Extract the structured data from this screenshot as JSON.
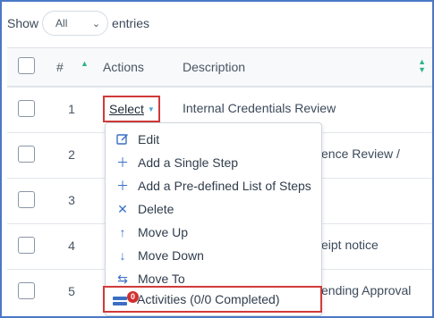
{
  "length_control": {
    "show_label": "Show",
    "selected": "All",
    "entries_label": "entries"
  },
  "table": {
    "headers": {
      "number": "#",
      "actions": "Actions",
      "description": "Description"
    },
    "rows": [
      {
        "number": "1",
        "description": "Internal Credentials Review"
      },
      {
        "number": "2",
        "description": "ence Review /"
      },
      {
        "number": "3",
        "description": ""
      },
      {
        "number": "4",
        "description": "eipt notice"
      },
      {
        "number": "5",
        "description": "ending Approval"
      }
    ],
    "select_label": "Select"
  },
  "action_menu": {
    "items": [
      {
        "label": "Edit",
        "icon": "edit-icon"
      },
      {
        "label": "Add a Single Step",
        "icon": "plus-icon"
      },
      {
        "label": "Add a Pre-defined List of Steps",
        "icon": "plus-icon"
      },
      {
        "label": "Delete",
        "icon": "close-icon"
      },
      {
        "label": "Move Up",
        "icon": "arrow-up-icon"
      },
      {
        "label": "Move Down",
        "icon": "arrow-down-icon"
      },
      {
        "label": "Move To",
        "icon": "swap-arrows-icon"
      },
      {
        "label": "Activities (0/0 Completed)",
        "icon": "activities-icon",
        "badge": "0"
      }
    ]
  },
  "colors": {
    "accent": "#3a6fc4",
    "highlight_border": "#d13a3a",
    "sort_icon": "#30b38a",
    "frame_border": "#4a78c6"
  }
}
